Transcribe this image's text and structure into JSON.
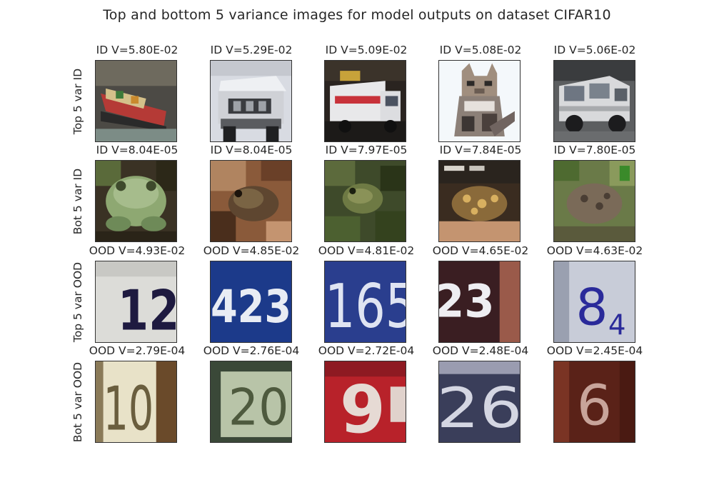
{
  "figure": {
    "title": "Top and bottom 5 variance images for model outputs on dataset CIFAR10"
  },
  "rows": [
    {
      "label": "Top 5 var ID",
      "cells": [
        {
          "caption": "ID V=5.80E-02",
          "subject": "boat"
        },
        {
          "caption": "ID V=5.29E-02",
          "subject": "truck-front"
        },
        {
          "caption": "ID V=5.09E-02",
          "subject": "truck-side"
        },
        {
          "caption": "ID V=5.08E-02",
          "subject": "cat"
        },
        {
          "caption": "ID V=5.06E-02",
          "subject": "suv"
        }
      ]
    },
    {
      "label": "Bot 5 var ID",
      "cells": [
        {
          "caption": "ID V=8.04E-05",
          "subject": "frog-green"
        },
        {
          "caption": "ID V=8.04E-05",
          "subject": "frog-brown"
        },
        {
          "caption": "ID V=7.97E-05",
          "subject": "frog-grass"
        },
        {
          "caption": "ID V=7.84E-05",
          "subject": "frog-spotted"
        },
        {
          "caption": "ID V=7.80E-05",
          "subject": "frog-leaves"
        }
      ]
    },
    {
      "label": "Top 5 var OOD",
      "cells": [
        {
          "caption": "OOD V=4.93E-02",
          "subject": "digits-12"
        },
        {
          "caption": "OOD V=4.85E-02",
          "subject": "digits-423"
        },
        {
          "caption": "OOD V=4.81E-02",
          "subject": "digits-165"
        },
        {
          "caption": "OOD V=4.65E-02",
          "subject": "digits-23"
        },
        {
          "caption": "OOD V=4.63E-02",
          "subject": "digits-84"
        }
      ]
    },
    {
      "label": "Bot 5 var OOD",
      "cells": [
        {
          "caption": "OOD V=2.79E-04",
          "subject": "digits-10"
        },
        {
          "caption": "OOD V=2.76E-04",
          "subject": "digits-20"
        },
        {
          "caption": "OOD V=2.72E-04",
          "subject": "digits-9"
        },
        {
          "caption": "OOD V=2.48E-04",
          "subject": "digits-26"
        },
        {
          "caption": "OOD V=2.45E-04",
          "subject": "digits-6"
        }
      ]
    }
  ]
}
